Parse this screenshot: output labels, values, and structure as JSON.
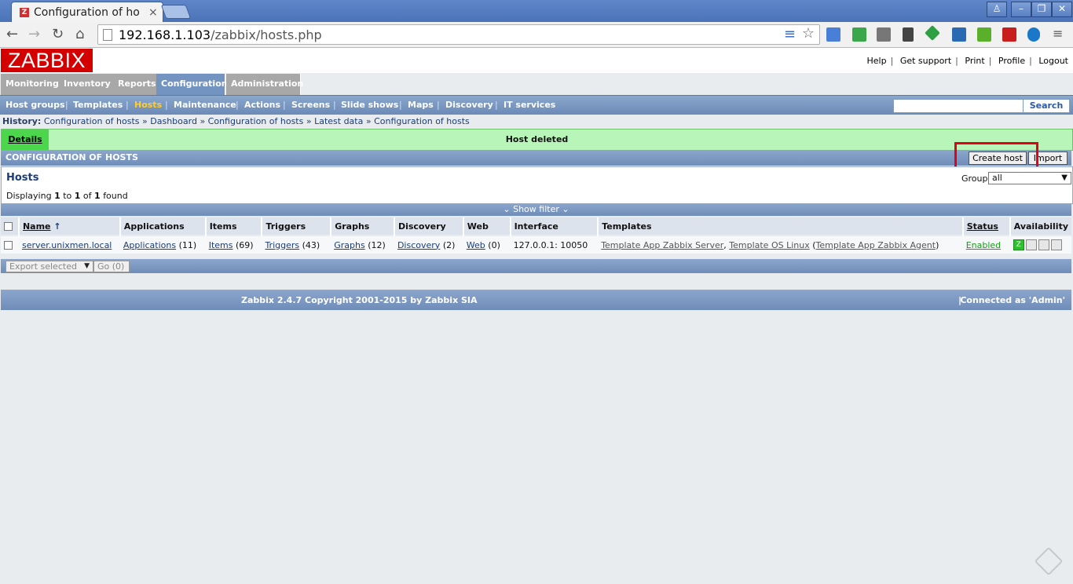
{
  "browser": {
    "tab_title": "Configuration of ho",
    "tab_close": "×",
    "url_host": "192.168.1.103",
    "url_path": "/zabbix/hosts.php",
    "nav_back": "←",
    "nav_forward": "→",
    "nav_reload": "↻",
    "nav_home": "⌂",
    "menu_icon": "≡",
    "star_icon": "☆"
  },
  "zabbix": {
    "logo": "ZABBIX",
    "top_links": [
      "Help",
      "Get support",
      "Print",
      "Profile",
      "Logout"
    ],
    "main_menu": [
      "Monitoring",
      "Inventory",
      "Reports",
      "Configuration",
      "Administration"
    ],
    "main_menu_active": "Configuration",
    "sub_menu": [
      "Host groups",
      "Templates",
      "Hosts",
      "Maintenance",
      "Actions",
      "Screens",
      "Slide shows",
      "Maps",
      "Discovery",
      "IT services"
    ],
    "sub_menu_active": "Hosts",
    "search_button": "Search",
    "history_label": "History:",
    "history": [
      "Configuration of hosts",
      "Dashboard",
      "Configuration of hosts",
      "Latest data",
      "Configuration of hosts"
    ],
    "history_sep": "»",
    "message_details": "Details",
    "message_text": "Host deleted",
    "section_title": "CONFIGURATION OF HOSTS",
    "create_host": "Create host",
    "import": "Import",
    "hosts_title": "Hosts",
    "displaying": {
      "prefix": "Displaying",
      "from": "1",
      "to_word": "to",
      "to": "1",
      "of_word": "of",
      "total": "1",
      "suffix": "found"
    },
    "group_label": "Group",
    "group_value": "all",
    "show_filter": "⌄ Show filter ⌄",
    "columns": [
      "Name",
      "Applications",
      "Items",
      "Triggers",
      "Graphs",
      "Discovery",
      "Web",
      "Interface",
      "Templates",
      "Status",
      "Availability"
    ],
    "sort_arrow": "↑",
    "row": {
      "name": "server.unixmen.local",
      "applications": "Applications",
      "applications_count": "(11)",
      "items": "Items",
      "items_count": "(69)",
      "triggers": "Triggers",
      "triggers_count": "(43)",
      "graphs": "Graphs",
      "graphs_count": "(12)",
      "discovery": "Discovery",
      "discovery_count": "(2)",
      "web": "Web",
      "web_count": "(0)",
      "interface": "127.0.0.1: 10050",
      "template1": "Template App Zabbix Server",
      "template_sep": ",",
      "template2": "Template OS Linux",
      "template_open": "(",
      "template3": "Template App Zabbix Agent",
      "template_close": ")",
      "status": "Enabled",
      "avail_z": "Z"
    },
    "export_selected": "Export selected",
    "go": "Go (0)",
    "footer_copy": "Zabbix 2.4.7 Copyright 2001-2015 by Zabbix SIA",
    "footer_sep": "|",
    "footer_connected": "Connected as 'Admin'"
  }
}
